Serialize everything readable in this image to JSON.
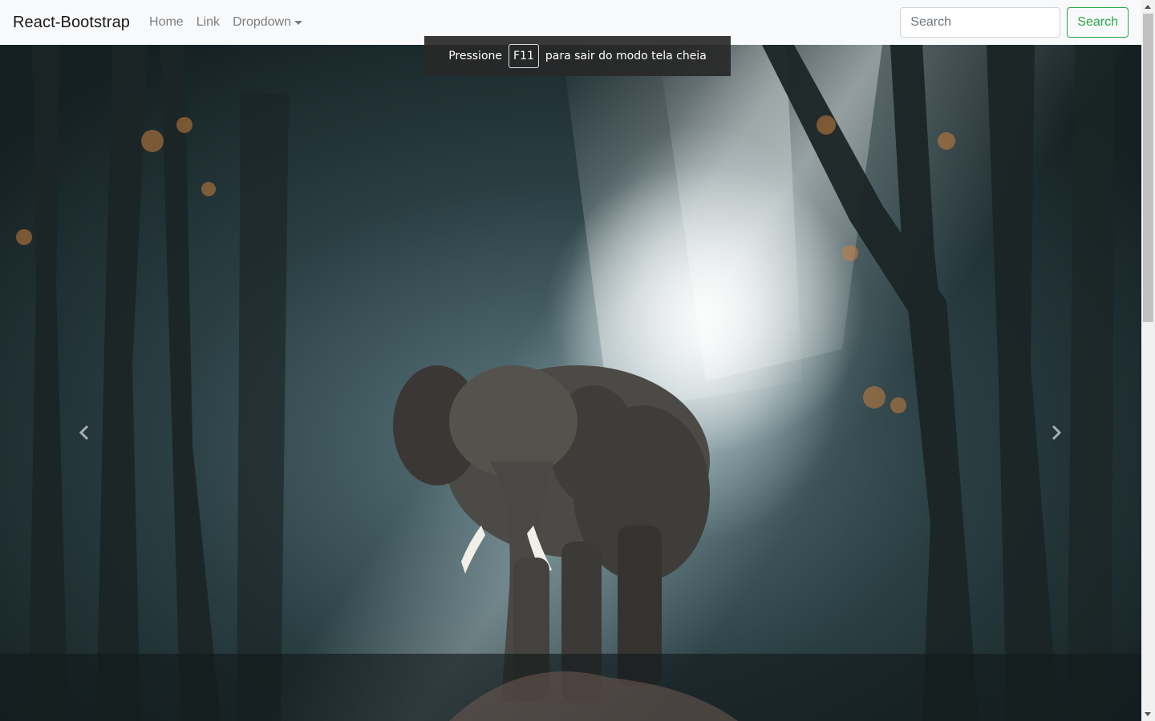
{
  "navbar": {
    "brand": "React-Bootstrap",
    "links": [
      {
        "label": "Home"
      },
      {
        "label": "Link"
      },
      {
        "label": "Dropdown"
      }
    ],
    "search": {
      "placeholder": "Search",
      "button_label": "Search"
    }
  },
  "fullscreen_notice": {
    "prefix": "Pressione",
    "key": "F11",
    "suffix": "para sair do modo tela cheia"
  },
  "carousel": {
    "prev_icon": "chevron-left-icon",
    "next_icon": "chevron-right-icon"
  },
  "colors": {
    "navbar_bg": "#f8f9fa",
    "success": "#28a745",
    "muted_link": "rgba(0,0,0,0.5)"
  }
}
